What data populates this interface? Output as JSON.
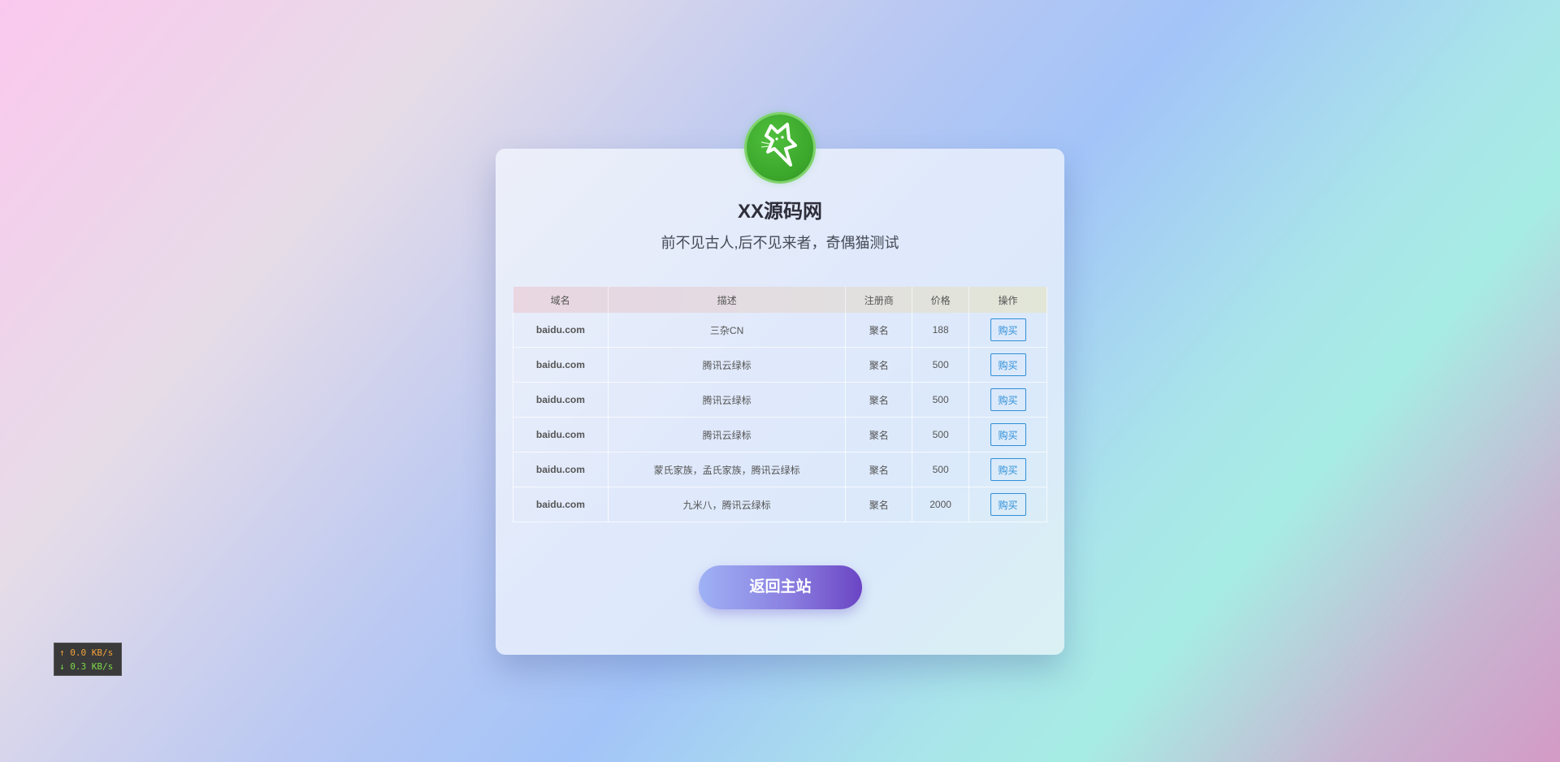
{
  "site": {
    "title": "XX源码网",
    "subtitle": "前不见古人,后不见来者，奇偶猫测试",
    "logo_icon": "lightning-cat-icon"
  },
  "table": {
    "headers": [
      "域名",
      "描述",
      "注册商",
      "价格",
      "操作"
    ],
    "rows": [
      {
        "domain": "baidu.com",
        "desc": "三杂CN",
        "registrar": "聚名",
        "price": "188",
        "action": "购买"
      },
      {
        "domain": "baidu.com",
        "desc": "腾讯云绿标",
        "registrar": "聚名",
        "price": "500",
        "action": "购买"
      },
      {
        "domain": "baidu.com",
        "desc": "腾讯云绿标",
        "registrar": "聚名",
        "price": "500",
        "action": "购买"
      },
      {
        "domain": "baidu.com",
        "desc": "腾讯云绿标",
        "registrar": "聚名",
        "price": "500",
        "action": "购买"
      },
      {
        "domain": "baidu.com",
        "desc": "蒙氏家族，孟氏家族，腾讯云绿标",
        "registrar": "聚名",
        "price": "500",
        "action": "购买"
      },
      {
        "domain": "baidu.com",
        "desc": "九米八，腾讯云绿标",
        "registrar": "聚名",
        "price": "2000",
        "action": "购买"
      }
    ]
  },
  "home_button": {
    "label": "返回主站"
  },
  "netspeed": {
    "up": "↑ 0.0 KB/s",
    "down": "↓ 0.3 KB/s"
  },
  "colors": {
    "accent": "#2f8fd8",
    "logo_green": "#3aa52a",
    "button_start": "#9fb2f5",
    "button_end": "#6b45c4"
  }
}
